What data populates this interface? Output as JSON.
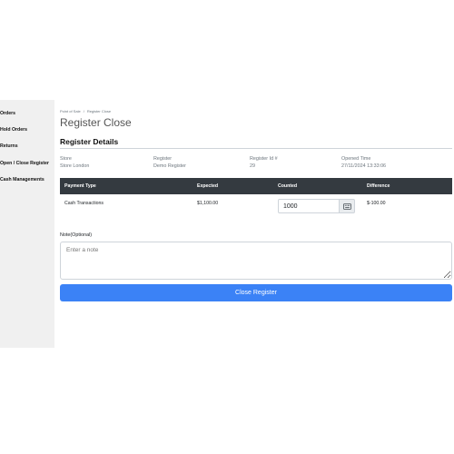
{
  "sidebar": {
    "items": [
      {
        "label": "Orders"
      },
      {
        "label": "Hold Orders"
      },
      {
        "label": "Returns"
      },
      {
        "label": "Open / Close Register"
      },
      {
        "label": "Cash Managements"
      }
    ]
  },
  "breadcrumb": {
    "items": [
      "Point of Sale",
      "Register Close"
    ],
    "separator": "/"
  },
  "page_title": "Register Close",
  "section_title": "Register Details",
  "details": [
    {
      "label": "Store",
      "value": "Store London"
    },
    {
      "label": "Register",
      "value": "Demo Register"
    },
    {
      "label": "Register Id #",
      "value": "29"
    },
    {
      "label": "Opened Time",
      "value": "27/11/2024 13:33:06"
    }
  ],
  "table": {
    "headers": [
      "Payment Type",
      "Expected",
      "Counted",
      "Difference"
    ],
    "rows": [
      {
        "payment_type": "Cash Transactions",
        "expected": "$1,100.00",
        "counted": "1000",
        "difference": "$-100.00"
      }
    ]
  },
  "note": {
    "label": "Note(Optional)",
    "placeholder": "Enter a note",
    "value": ""
  },
  "close_button_label": "Close Register",
  "colors": {
    "sidebar_bg": "#f0f0f0",
    "table_header_bg": "#343a40",
    "primary_button": "#3b82f6"
  },
  "icons": {
    "keyboard": "keyboard-icon"
  }
}
